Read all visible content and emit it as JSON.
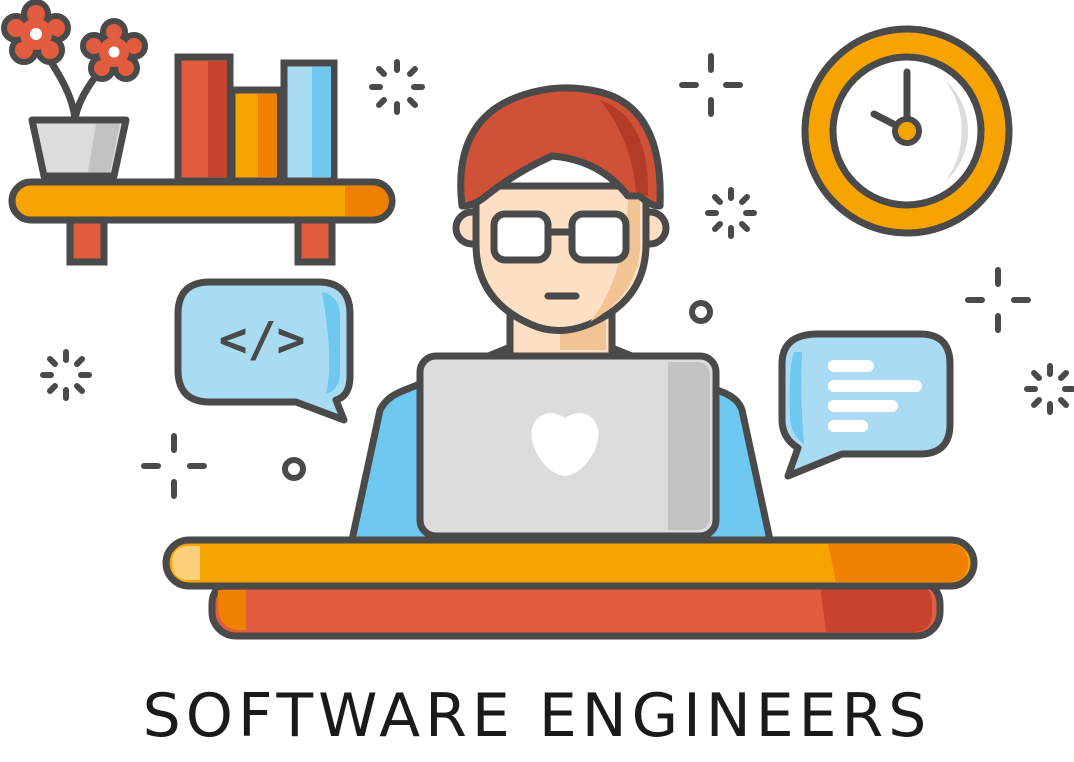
{
  "caption": "SOFTWARE ENGINEERS",
  "speech_bubble_left": {
    "symbol": "</>"
  },
  "colors": {
    "outline": "#4a4a4a",
    "orange": "#f7a400",
    "orange_dark": "#f08000",
    "red": "#e25c40",
    "red_dark": "#c7432e",
    "hair": "#cf5238",
    "skin": "#fde0c3",
    "skin_shadow": "#f3c493",
    "light_blue": "#a9dcf2",
    "shirt_blue": "#6ec8f0",
    "laptop_gray": "#dcdcdc",
    "laptop_gray_dark": "#c2c2c2",
    "white": "#ffffff",
    "caption_text": "#1a1a1a"
  },
  "icons": [
    "flower-pot-icon",
    "books-icon",
    "wall-shelf-icon",
    "wall-clock-icon",
    "code-speech-bubble-icon",
    "text-speech-bubble-icon",
    "developer-person-icon",
    "laptop-icon",
    "desk-icon",
    "sparkle-icon"
  ]
}
